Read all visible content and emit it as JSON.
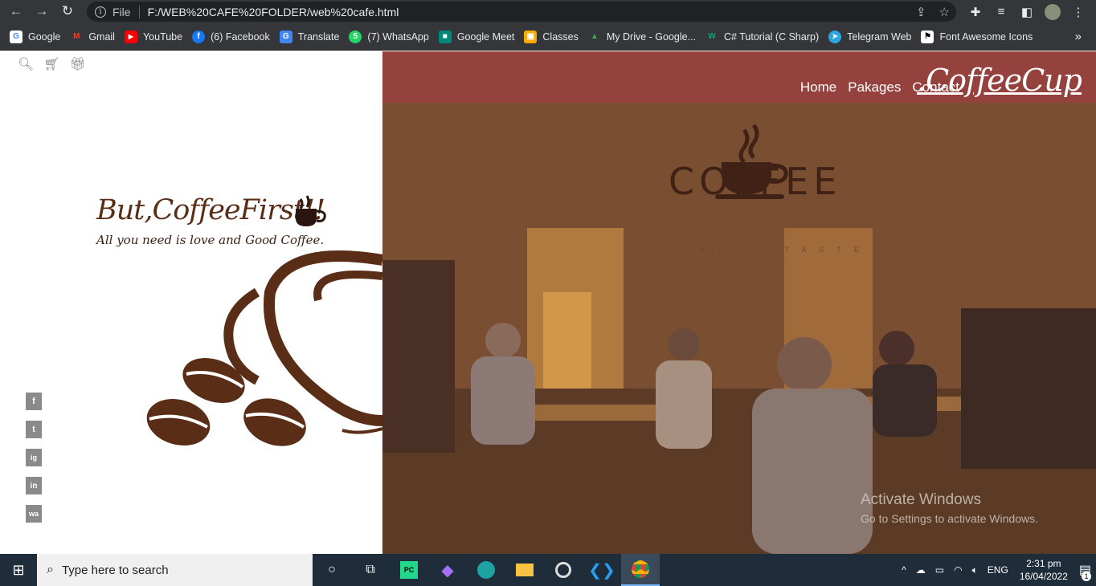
{
  "browser": {
    "url_scheme": "File",
    "url": "F:/WEB%20CAFE%20FOLDER/web%20cafe.html",
    "bookmarks": [
      {
        "label": "Google",
        "color": "#4285f4",
        "icon": "G"
      },
      {
        "label": "Gmail",
        "color": "#ea4335",
        "icon": "M"
      },
      {
        "label": "YouTube",
        "color": "#ff0000",
        "icon": "▶"
      },
      {
        "label": "(6) Facebook",
        "color": "#1877f2",
        "icon": "f"
      },
      {
        "label": "Translate",
        "color": "#4285f4",
        "icon": "G"
      },
      {
        "label": "(7) WhatsApp",
        "color": "#25d366",
        "icon": "5"
      },
      {
        "label": "Google Meet",
        "color": "#00897b",
        "icon": "■"
      },
      {
        "label": "Classes",
        "color": "#f9ab00",
        "icon": "▣"
      },
      {
        "label": "My Drive - Google...",
        "color": "#34a853",
        "icon": "▲"
      },
      {
        "label": "C# Tutorial (C Sharp)",
        "color": "#04aa6d",
        "icon": "W"
      },
      {
        "label": "Telegram Web",
        "color": "#2ca5e0",
        "icon": "➤"
      },
      {
        "label": "Font Awesome Icons",
        "color": "#ffffff",
        "icon": "⚑"
      }
    ],
    "more": "»"
  },
  "site": {
    "nav": [
      "Home",
      "Pakages",
      "Contact"
    ],
    "brand": ".CoffeeCup",
    "tagline": "But,CoffeeFirst!!",
    "subline": "All you need is love and Good Coffee.",
    "logo_word": "COFFEE",
    "logo_sub": "GREAT TASTE",
    "social": [
      "f",
      "t",
      "ig",
      "in",
      "wa"
    ],
    "colors": {
      "header": "#95413e",
      "coffee_brown": "#5a2d17"
    }
  },
  "watermark": {
    "title": "Activate Windows",
    "sub": "Go to Settings to activate Windows."
  },
  "taskbar": {
    "search_placeholder": "Type here to search",
    "lang": "ENG",
    "time": "2:31 pm",
    "date": "16/04/2022",
    "notif_count": "1"
  }
}
